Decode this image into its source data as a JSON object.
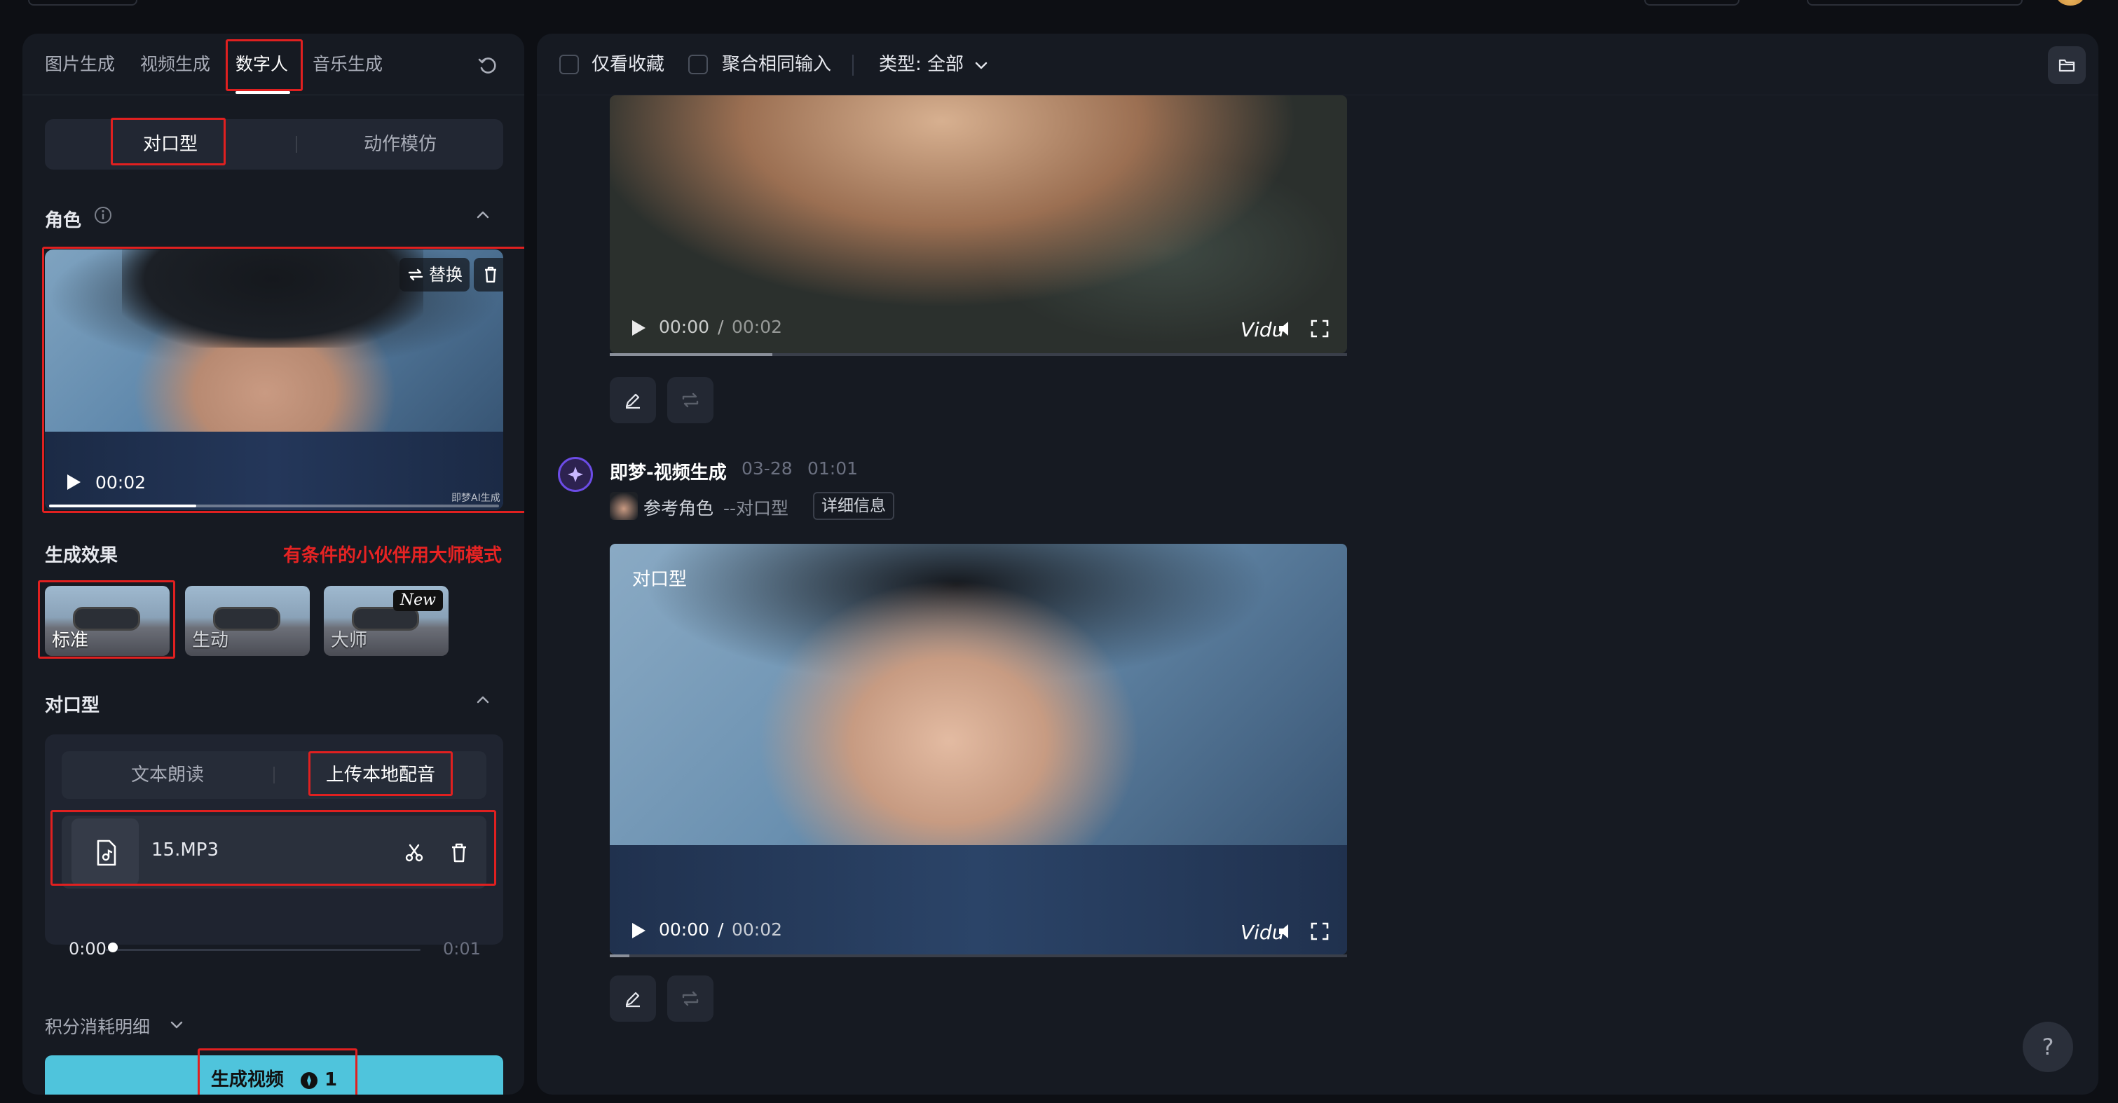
{
  "left_panel": {
    "tabs": [
      {
        "label": "图片生成"
      },
      {
        "label": "视频生成"
      },
      {
        "label": "数字人"
      },
      {
        "label": "音乐生成"
      }
    ],
    "mode_segment": {
      "items": [
        {
          "label": "对口型"
        },
        {
          "label": "动作模仿"
        }
      ]
    },
    "role": {
      "title": "角色",
      "replace_label": "替换",
      "time": "00:02",
      "watermark": "即梦AI生成"
    },
    "effect": {
      "title": "生成效果",
      "note": "有条件的小伙伴用大师模式",
      "options": [
        {
          "label": "标准"
        },
        {
          "label": "生动"
        },
        {
          "label": "大师",
          "badge": "New"
        }
      ]
    },
    "lip": {
      "title": "对口型",
      "segment": [
        {
          "label": "文本朗读"
        },
        {
          "label": "上传本地配音"
        }
      ],
      "file_name": "15.MP3",
      "audio_current": "0:00",
      "audio_total": "0:01"
    },
    "points_label": "积分消耗明细",
    "generate": {
      "label": "生成视频",
      "cost": "1"
    }
  },
  "right_panel": {
    "filters": {
      "only_favorites": "仅看收藏",
      "group_same_input": "聚合相同输入",
      "type_label": "类型: 全部"
    },
    "video1": {
      "current": "00:00",
      "sep": "/",
      "total": "00:02",
      "watermark": "Vidu"
    },
    "generation": {
      "title": "即梦-视频生成",
      "date": "03-28",
      "clock": "01:01",
      "ref_label": "参考角色",
      "ref_type": "--对口型",
      "detail_label": "详细信息"
    },
    "video2": {
      "tag": "对口型",
      "current": "00:00",
      "sep": "/",
      "total": "00:02",
      "watermark": "Vidu"
    },
    "help": "?"
  },
  "colors": {
    "panel": "#161a22",
    "accent": "#4fc4dc",
    "annotation": "#e02020"
  }
}
